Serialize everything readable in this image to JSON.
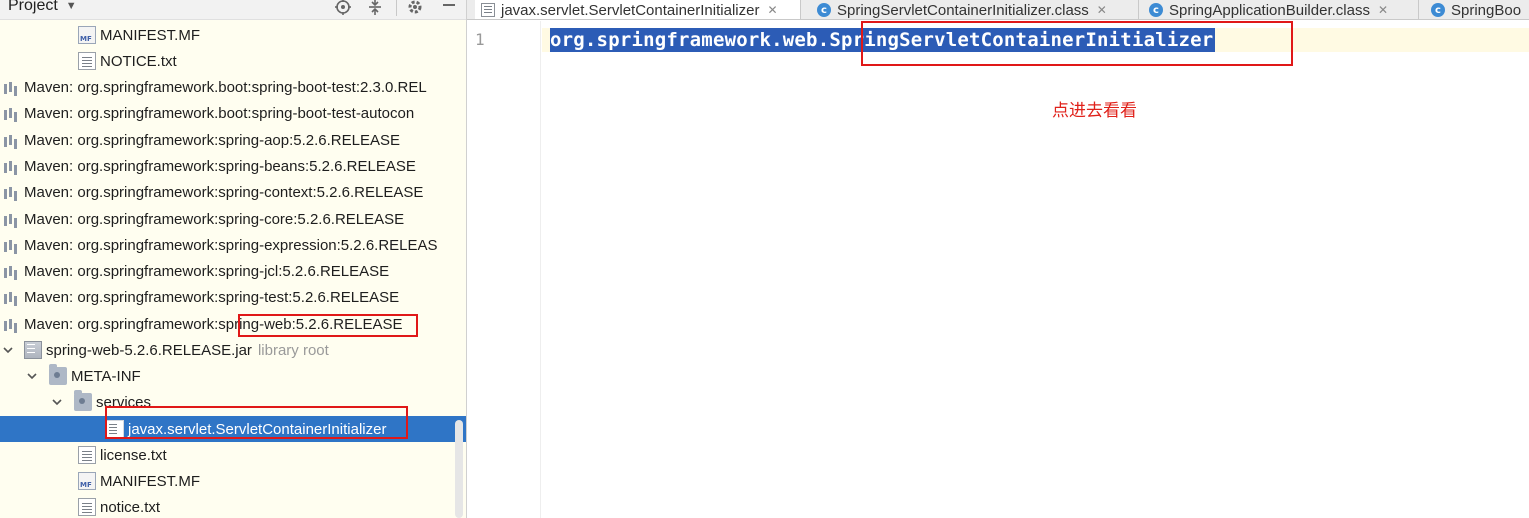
{
  "project_panel": {
    "title": "Project",
    "tree": [
      {
        "label": "MANIFEST.MF",
        "icon": "manifest-icon"
      },
      {
        "label": "NOTICE.txt",
        "icon": "text-file-icon"
      },
      {
        "label": "Maven: org.springframework.boot:spring-boot-test:2.3.0.REL",
        "icon": "library-icon"
      },
      {
        "label": "Maven: org.springframework.boot:spring-boot-test-autocon",
        "icon": "library-icon"
      },
      {
        "label": "Maven: org.springframework:spring-aop:5.2.6.RELEASE",
        "icon": "library-icon"
      },
      {
        "label": "Maven: org.springframework:spring-beans:5.2.6.RELEASE",
        "icon": "library-icon"
      },
      {
        "label": "Maven: org.springframework:spring-context:5.2.6.RELEASE",
        "icon": "library-icon"
      },
      {
        "label": "Maven: org.springframework:spring-core:5.2.6.RELEASE",
        "icon": "library-icon"
      },
      {
        "label": "Maven: org.springframework:spring-expression:5.2.6.RELEAS",
        "icon": "library-icon"
      },
      {
        "label": "Maven: org.springframework:spring-jcl:5.2.6.RELEASE",
        "icon": "library-icon"
      },
      {
        "label": "Maven: org.springframework:spring-test:5.2.6.RELEASE",
        "icon": "library-icon"
      },
      {
        "label": "Maven: org.springframework:spring-web:5.2.6.RELEASE",
        "icon": "library-icon"
      },
      {
        "label": "spring-web-5.2.6.RELEASE.jar",
        "secondary": "library root",
        "icon": "jar-icon"
      },
      {
        "label": "META-INF",
        "icon": "folder-icon"
      },
      {
        "label": "services",
        "icon": "folder-icon"
      },
      {
        "label": "javax.servlet.ServletContainerInitializer",
        "icon": "file-icon"
      },
      {
        "label": "license.txt",
        "icon": "text-file-icon"
      },
      {
        "label": "MANIFEST.MF",
        "icon": "manifest-icon"
      },
      {
        "label": "notice.txt",
        "icon": "text-file-icon"
      }
    ]
  },
  "editor": {
    "tabs": [
      {
        "label": "javax.servlet.ServletContainerInitializer",
        "icon": "text-file-icon",
        "active": true
      },
      {
        "label": "SpringServletContainerInitializer.class",
        "icon": "class-icon",
        "active": false
      },
      {
        "label": "SpringApplicationBuilder.class",
        "icon": "class-icon",
        "active": false
      },
      {
        "label": "SpringBoo",
        "icon": "class-icon",
        "active": false
      }
    ],
    "line_number": "1",
    "code": "org.springframework.web.SpringServletContainerInitializer"
  },
  "annotation": {
    "note": "点进去看看",
    "color": "#e01818"
  },
  "colors": {
    "selection": "#2f75c6",
    "code_highlight": "#2c5cb6",
    "panel_background": "#fffef0"
  }
}
